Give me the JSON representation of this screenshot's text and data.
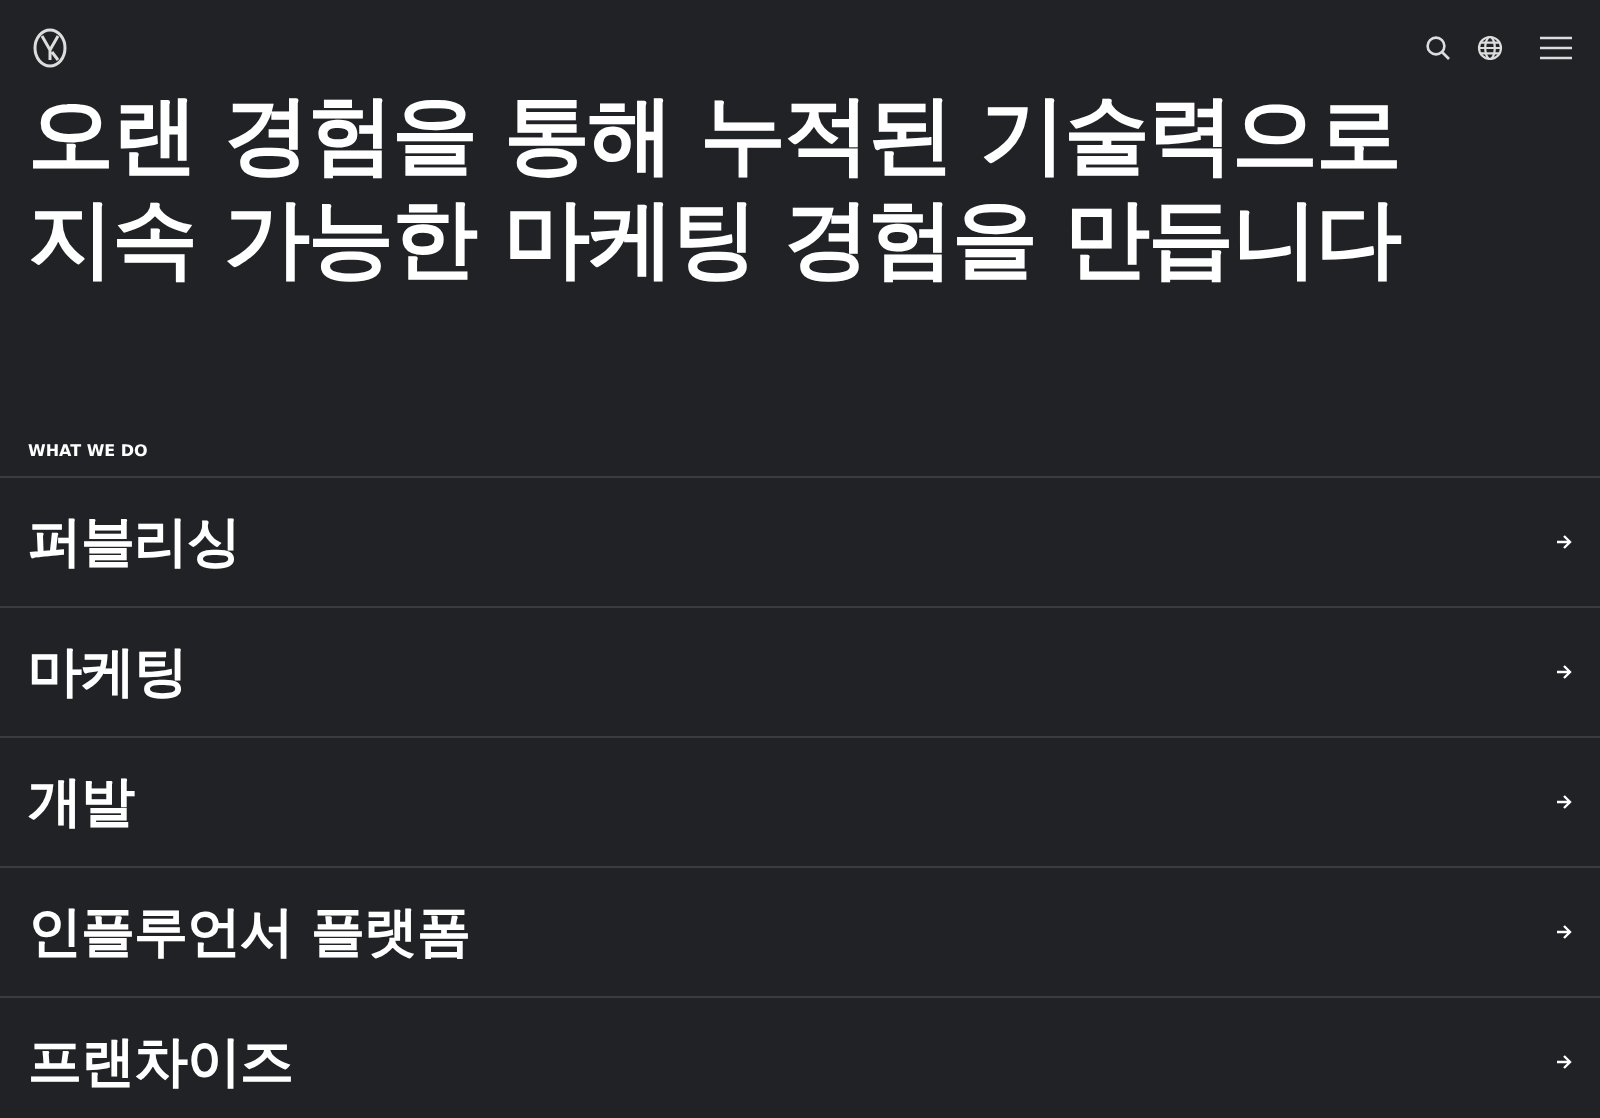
{
  "header": {
    "headline_lines": [
      "오랜 경험을 통해 누적된 기술력으로",
      "지속 가능한 마케팅 경험을 만듭니다"
    ]
  },
  "services": {
    "label": "WHAT WE DO",
    "items": [
      {
        "title": "퍼블리싱"
      },
      {
        "title": "마케팅"
      },
      {
        "title": "개발"
      },
      {
        "title": "인플루언서 플랫폼"
      },
      {
        "title": "프랜차이즈"
      }
    ]
  }
}
